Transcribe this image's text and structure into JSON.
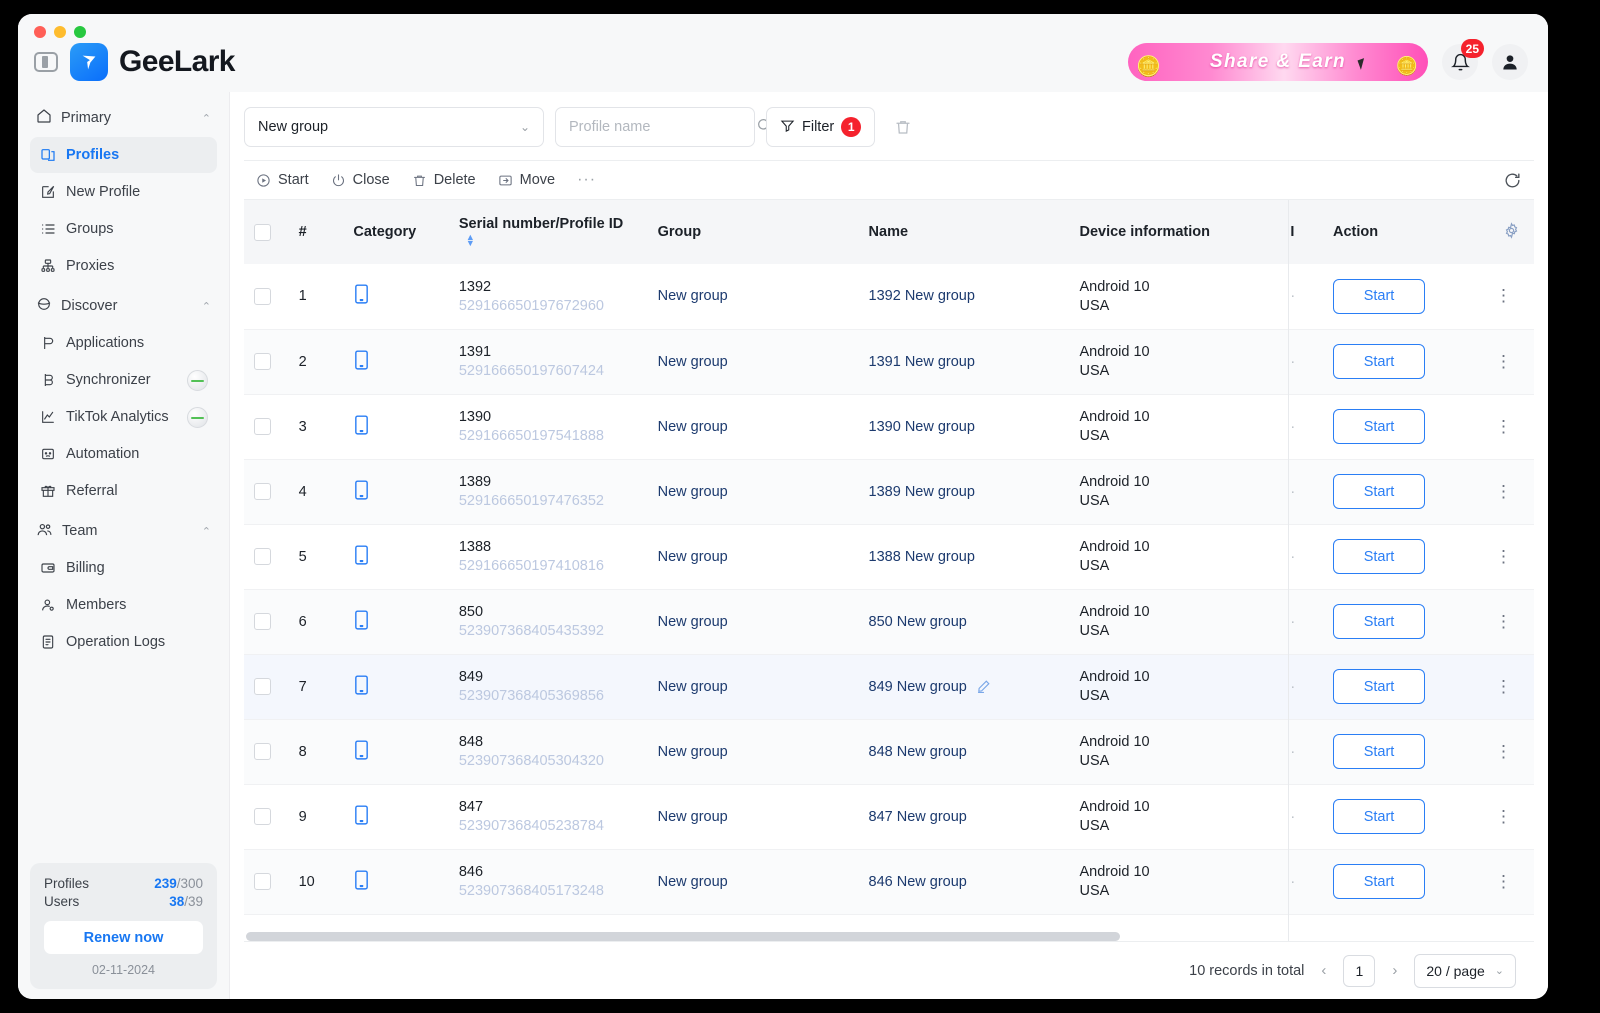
{
  "window": {
    "traffic_lights": [
      "close",
      "minimize",
      "maximize"
    ]
  },
  "header": {
    "brand_name": "GeeLark",
    "promo_label": "Share  &  Earn",
    "notification_count": "25"
  },
  "sidebar": {
    "sections": [
      {
        "label": "Primary",
        "icon": "home-icon",
        "items": [
          {
            "label": "Profiles",
            "icon": "profiles-icon",
            "active": true
          },
          {
            "label": "New Profile",
            "icon": "new-profile-icon",
            "active": false
          },
          {
            "label": "Groups",
            "icon": "groups-icon",
            "active": false
          },
          {
            "label": "Proxies",
            "icon": "proxies-icon",
            "active": false
          }
        ]
      },
      {
        "label": "Discover",
        "icon": "discover-icon",
        "items": [
          {
            "label": "Applications",
            "icon": "applications-icon",
            "active": false
          },
          {
            "label": "Synchronizer",
            "icon": "synchronizer-icon",
            "active": false,
            "toggle": true
          },
          {
            "label": "TikTok Analytics",
            "icon": "analytics-icon",
            "active": false,
            "toggle": true
          },
          {
            "label": "Automation",
            "icon": "automation-icon",
            "active": false
          },
          {
            "label": "Referral",
            "icon": "referral-icon",
            "active": false
          }
        ]
      },
      {
        "label": "Team",
        "icon": "team-icon",
        "items": [
          {
            "label": "Billing",
            "icon": "billing-icon",
            "active": false
          },
          {
            "label": "Members",
            "icon": "members-icon",
            "active": false
          },
          {
            "label": "Operation Logs",
            "icon": "operation-logs-icon",
            "active": false
          }
        ]
      }
    ],
    "plan": {
      "profiles_label": "Profiles",
      "profiles_used": "239",
      "profiles_total": "/300",
      "users_label": "Users",
      "users_used": "38",
      "users_total": "/39",
      "renew_label": "Renew now",
      "expiry_date": "02-11-2024"
    }
  },
  "toolbar": {
    "group_selected": "New group",
    "search_placeholder": "Profile name",
    "search_value": "",
    "filter_label": "Filter",
    "filter_count": "1",
    "actions": [
      {
        "label": "Start",
        "icon": "play-circle-icon"
      },
      {
        "label": "Close",
        "icon": "power-icon"
      },
      {
        "label": "Delete",
        "icon": "trash-icon"
      },
      {
        "label": "Move",
        "icon": "move-icon"
      }
    ],
    "more_label": "···"
  },
  "table": {
    "columns": [
      "#",
      "Category",
      "Serial number/Profile ID",
      "Group",
      "Name",
      "Device information",
      "I",
      "Action"
    ],
    "rows": [
      {
        "num": "1",
        "category_icon": "phone-icon",
        "serial": "1392",
        "profile_id": "529166650197672960",
        "group": "New group",
        "name": "1392 New group",
        "device_os": "Android 10",
        "device_region": "USA",
        "cut": "·",
        "action": "Start",
        "hovered": false
      },
      {
        "num": "2",
        "category_icon": "phone-icon",
        "serial": "1391",
        "profile_id": "529166650197607424",
        "group": "New group",
        "name": "1391 New group",
        "device_os": "Android 10",
        "device_region": "USA",
        "cut": "·",
        "action": "Start",
        "hovered": false
      },
      {
        "num": "3",
        "category_icon": "phone-icon",
        "serial": "1390",
        "profile_id": "529166650197541888",
        "group": "New group",
        "name": "1390 New group",
        "device_os": "Android 10",
        "device_region": "USA",
        "cut": "·",
        "action": "Start",
        "hovered": false
      },
      {
        "num": "4",
        "category_icon": "phone-icon",
        "serial": "1389",
        "profile_id": "529166650197476352",
        "group": "New group",
        "name": "1389 New group",
        "device_os": "Android 10",
        "device_region": "USA",
        "cut": "·",
        "action": "Start",
        "hovered": false
      },
      {
        "num": "5",
        "category_icon": "phone-icon",
        "serial": "1388",
        "profile_id": "529166650197410816",
        "group": "New group",
        "name": "1388 New group",
        "device_os": "Android 10",
        "device_region": "USA",
        "cut": "·",
        "action": "Start",
        "hovered": false
      },
      {
        "num": "6",
        "category_icon": "phone-icon",
        "serial": "850",
        "profile_id": "523907368405435392",
        "group": "New group",
        "name": "850 New group",
        "device_os": "Android 10",
        "device_region": "USA",
        "cut": "·",
        "action": "Start",
        "hovered": false
      },
      {
        "num": "7",
        "category_icon": "phone-icon",
        "serial": "849",
        "profile_id": "523907368405369856",
        "group": "New group",
        "name": "849 New group",
        "device_os": "Android 10",
        "device_region": "USA",
        "cut": "·",
        "action": "Start",
        "hovered": true
      },
      {
        "num": "8",
        "category_icon": "phone-icon",
        "serial": "848",
        "profile_id": "523907368405304320",
        "group": "New group",
        "name": "848 New group",
        "device_os": "Android 10",
        "device_region": "USA",
        "cut": "·",
        "action": "Start",
        "hovered": false
      },
      {
        "num": "9",
        "category_icon": "phone-icon",
        "serial": "847",
        "profile_id": "523907368405238784",
        "group": "New group",
        "name": "847 New group",
        "device_os": "Android 10",
        "device_region": "USA",
        "cut": "·",
        "action": "Start",
        "hovered": false
      },
      {
        "num": "10",
        "category_icon": "phone-icon",
        "serial": "846",
        "profile_id": "523907368405173248",
        "group": "New group",
        "name": "846 New group",
        "device_os": "Android 10",
        "device_region": "USA",
        "cut": "·",
        "action": "Start",
        "hovered": false
      }
    ]
  },
  "footer": {
    "records_total": "10 records in total",
    "prev_label": "‹",
    "current_page": "1",
    "next_label": "›",
    "page_size": "20 / page"
  },
  "colors": {
    "accent": "#1877f2",
    "action_blue": "#2a7ef5",
    "badge_red": "#f5222d",
    "profile_id": "#bcc8e0",
    "link_navy": "#1c3a6e"
  }
}
